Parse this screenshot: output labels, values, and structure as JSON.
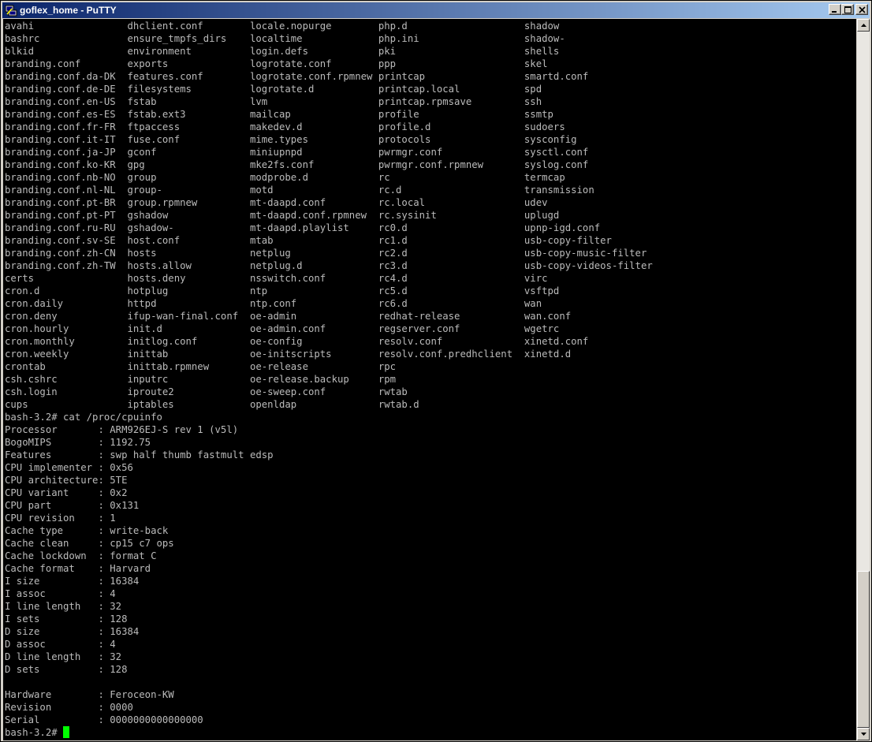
{
  "window": {
    "title": "goflex_home - PuTTY"
  },
  "titlebar_buttons": [
    "minimize",
    "maximize",
    "close"
  ],
  "terminal": {
    "lines": [
      "avahi                dhclient.conf        locale.nopurge        php.d                    shadow",
      "bashrc               ensure_tmpfs_dirs    localtime             php.ini                  shadow-",
      "blkid                environment          login.defs            pki                      shells",
      "branding.conf        exports              logrotate.conf        ppp                      skel",
      "branding.conf.da-DK  features.conf        logrotate.conf.rpmnew printcap                 smartd.conf",
      "branding.conf.de-DE  filesystems          logrotate.d           printcap.local           spd",
      "branding.conf.en-US  fstab                lvm                   printcap.rpmsave         ssh",
      "branding.conf.es-ES  fstab.ext3           mailcap               profile                  ssmtp",
      "branding.conf.fr-FR  ftpaccess            makedev.d             profile.d                sudoers",
      "branding.conf.it-IT  fuse.conf            mime.types            protocols                sysconfig",
      "branding.conf.ja-JP  gconf                miniupnpd             pwrmgr.conf              sysctl.conf",
      "branding.conf.ko-KR  gpg                  mke2fs.conf           pwrmgr.conf.rpmnew       syslog.conf",
      "branding.conf.nb-NO  group                modprobe.d            rc                       termcap",
      "branding.conf.nl-NL  group-               motd                  rc.d                     transmission",
      "branding.conf.pt-BR  group.rpmnew         mt-daapd.conf         rc.local                 udev",
      "branding.conf.pt-PT  gshadow              mt-daapd.conf.rpmnew  rc.sysinit               uplugd",
      "branding.conf.ru-RU  gshadow-             mt-daapd.playlist     rc0.d                    upnp-igd.conf",
      "branding.conf.sv-SE  host.conf            mtab                  rc1.d                    usb-copy-filter",
      "branding.conf.zh-CN  hosts                netplug               rc2.d                    usb-copy-music-filter",
      "branding.conf.zh-TW  hosts.allow          netplug.d             rc3.d                    usb-copy-videos-filter",
      "certs                hosts.deny           nsswitch.conf         rc4.d                    virc",
      "cron.d               hotplug              ntp                   rc5.d                    vsftpd",
      "cron.daily           httpd                ntp.conf              rc6.d                    wan",
      "cron.deny            ifup-wan-final.conf  oe-admin              redhat-release           wan.conf",
      "cron.hourly          init.d               oe-admin.conf         regserver.conf           wgetrc",
      "cron.monthly         initlog.conf         oe-config             resolv.conf              xinetd.conf",
      "cron.weekly          inittab              oe-initscripts        resolv.conf.predhclient  xinetd.d",
      "crontab              inittab.rpmnew       oe-release            rpc",
      "csh.cshrc            inputrc              oe-release.backup     rpm",
      "csh.login            iproute2             oe-sweep.conf         rwtab",
      "cups                 iptables             openldap              rwtab.d",
      "bash-3.2# cat /proc/cpuinfo",
      "Processor       : ARM926EJ-S rev 1 (v5l)",
      "BogoMIPS        : 1192.75",
      "Features        : swp half thumb fastmult edsp",
      "CPU implementer : 0x56",
      "CPU architecture: 5TE",
      "CPU variant     : 0x2",
      "CPU part        : 0x131",
      "CPU revision    : 1",
      "Cache type      : write-back",
      "Cache clean     : cp15 c7 ops",
      "Cache lockdown  : format C",
      "Cache format    : Harvard",
      "I size          : 16384",
      "I assoc         : 4",
      "I line length   : 32",
      "I sets          : 128",
      "D size          : 16384",
      "D assoc         : 4",
      "D line length   : 32",
      "D sets          : 128",
      "",
      "Hardware        : Feroceon-KW",
      "Revision        : 0000",
      "Serial          : 0000000000000000"
    ],
    "prompt": "bash-3.2# ",
    "cursor_color": "#00ff00",
    "background": "#000000",
    "foreground": "#bbbbbb"
  },
  "scrollbar": {
    "position": 0.76
  }
}
